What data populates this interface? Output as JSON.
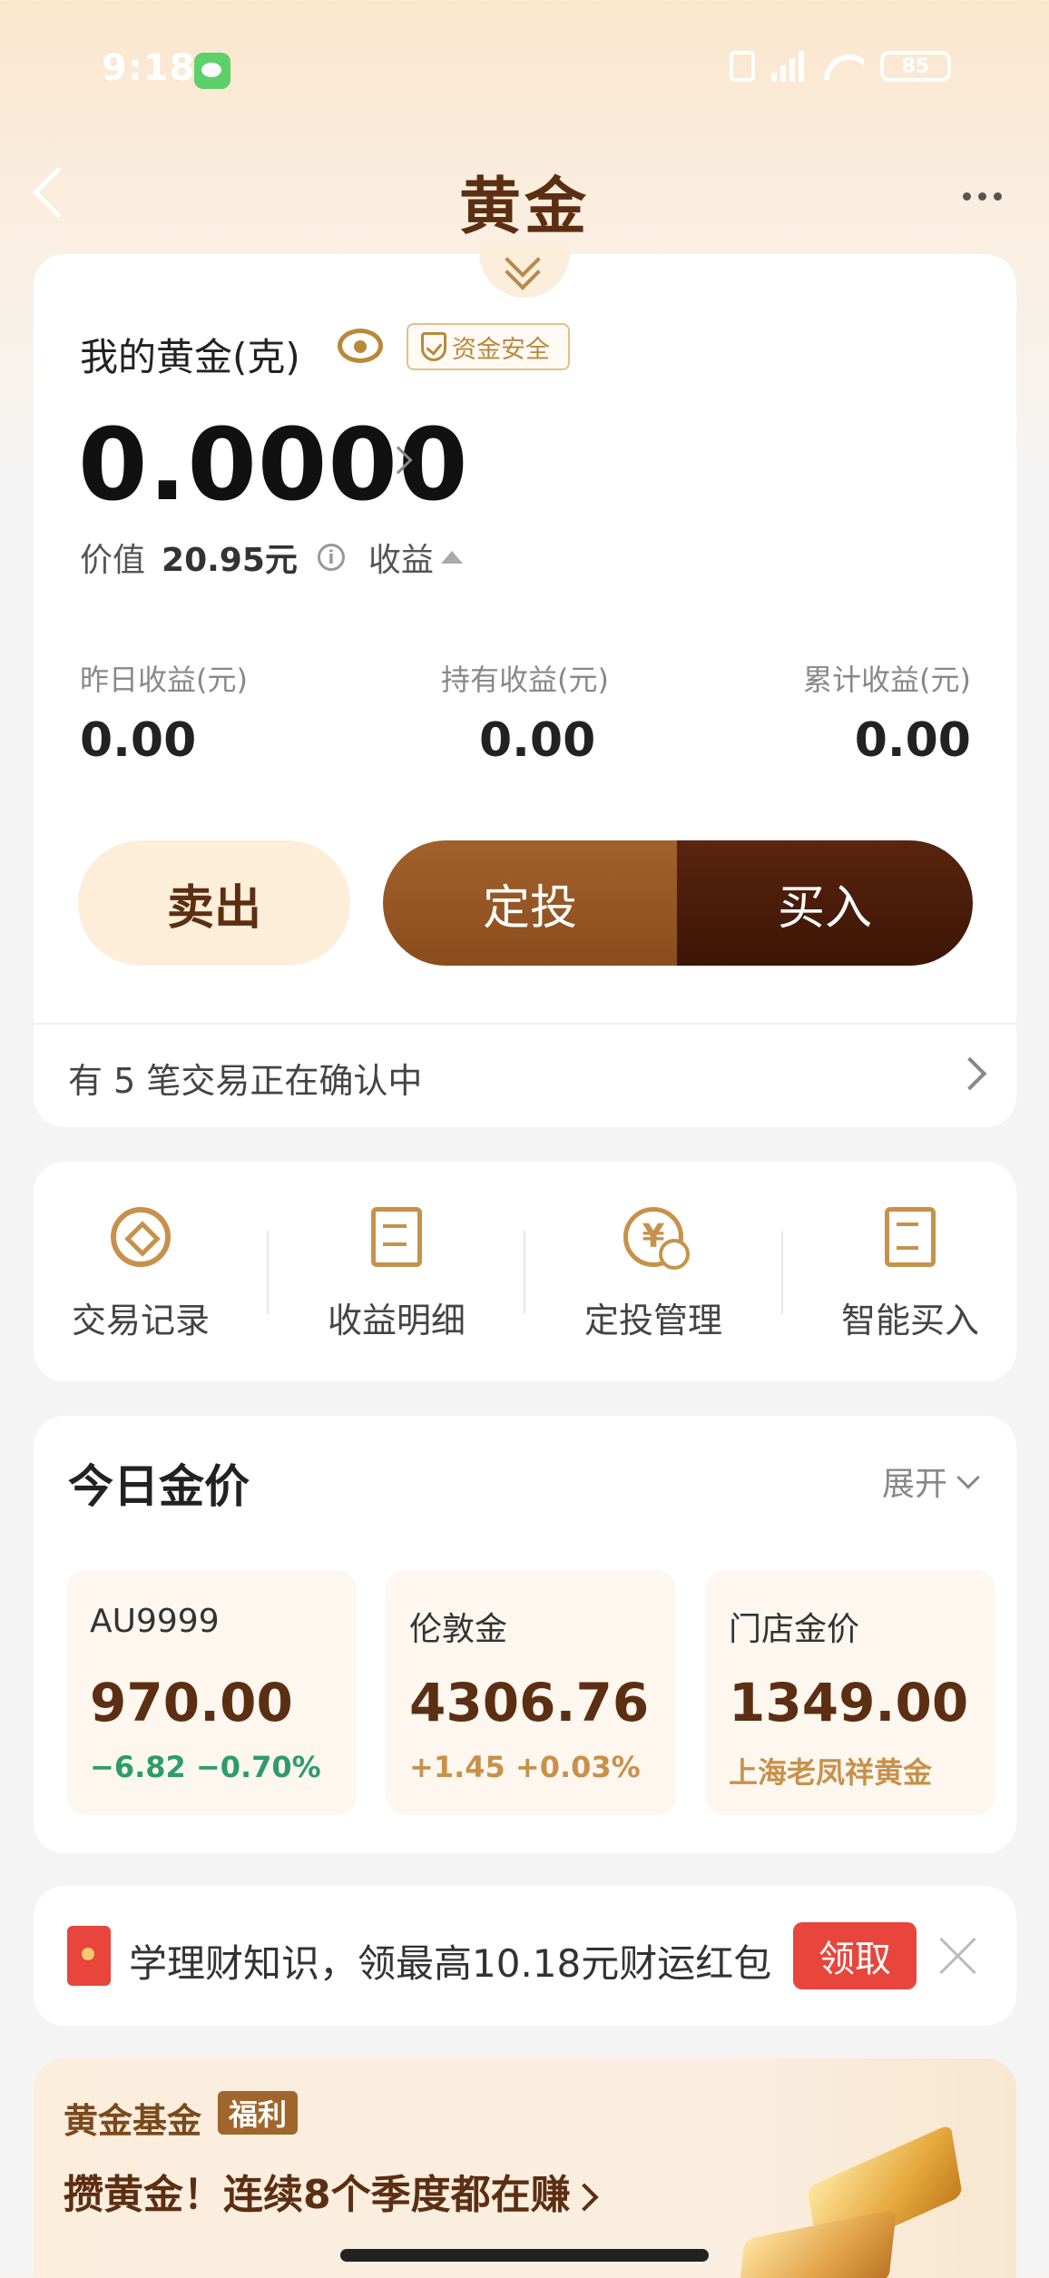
{
  "status_bar": {
    "time": "9:18",
    "battery": "85"
  },
  "nav": {
    "title": "黄金"
  },
  "holdings": {
    "label": "我的黄金(克)",
    "safe_badge": "资金安全",
    "grams": "0.0000",
    "value_label": "价值",
    "value_amount": "20.95元",
    "earnings_label": "收益",
    "stats": [
      {
        "label": "昨日收益(元)",
        "value": "0.00"
      },
      {
        "label": "持有收益(元)",
        "value": "0.00"
      },
      {
        "label": "累计收益(元)",
        "value": "0.00"
      }
    ],
    "buttons": {
      "sell": "卖出",
      "plan": "定投",
      "buy": "买入"
    },
    "pending": "有 5 笔交易正在确认中"
  },
  "quick_links": [
    {
      "label": "交易记录",
      "icon": "record-icon"
    },
    {
      "label": "收益明细",
      "icon": "detail-icon"
    },
    {
      "label": "定投管理",
      "icon": "plan-manage-icon",
      "glyph": "¥"
    },
    {
      "label": "智能买入",
      "icon": "smart-buy-icon"
    }
  ],
  "gold_price": {
    "title": "今日金价",
    "expand": "展开",
    "tiles": [
      {
        "name": "AU9999",
        "price": "970.00",
        "change": "−6.82  −0.70%",
        "change_color": "#2e9b6a"
      },
      {
        "name": "伦敦金",
        "price": "4306.76",
        "change": "+1.45  +0.03%",
        "change_color": "#c8914a"
      },
      {
        "name": "门店金价",
        "price": "1349.00",
        "change": "上海老凤祥黄金",
        "change_color": "#c8914a"
      }
    ]
  },
  "promo": {
    "text": "学理财知识，领最高10.18元财运红包",
    "button": "领取"
  },
  "banner": {
    "title": "黄金基金",
    "tag": "福利",
    "slogan": "攒黄金！连续8个季度都在赚"
  },
  "colors": {
    "brand_brown": "#5c2e12",
    "gold": "#c8914a",
    "red": "#e8453c",
    "down_green": "#2e9b6a"
  }
}
